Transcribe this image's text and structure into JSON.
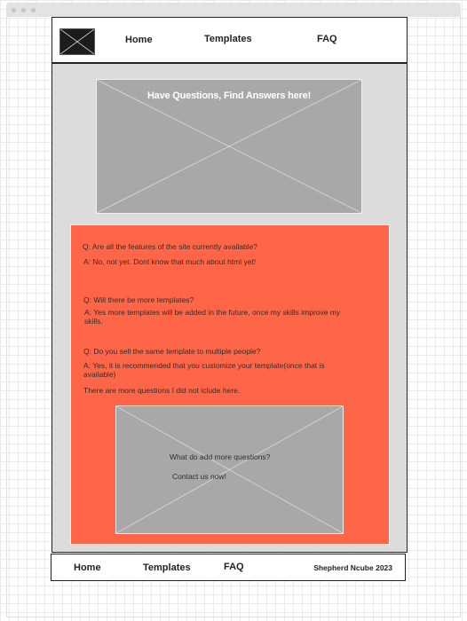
{
  "nav": {
    "home": "Home",
    "templates": "Templates",
    "faq": "FAQ"
  },
  "hero": {
    "title": "Have Questions, Find Answers here!"
  },
  "faq": [
    {
      "q": "Q: Are all the features of the site currently available?",
      "a": "A: No, not yet. Dont know that much about html yet!"
    },
    {
      "q": "Q: Will there be more templates?",
      "a": "A: Yes more templates will be added in the future, once my skills improve my skills."
    },
    {
      "q": "Q: Do you sell the same template to multiple people?",
      "a": "A: Yes, it is recommended that you customize your template(once that is available)"
    }
  ],
  "faq_note": "There are more questions I did not iclude here.",
  "cta": {
    "line1": "What do add more questions?",
    "line2": "Contact us now!"
  },
  "footer": {
    "home": "Home",
    "templates": "Templates",
    "faq": "FAQ",
    "credit": "Shepherd Ncube 2023"
  },
  "colors": {
    "faq_panel": "#ff6647",
    "placeholder": "#a8a8a8",
    "main_bg": "#dcdcdc"
  }
}
